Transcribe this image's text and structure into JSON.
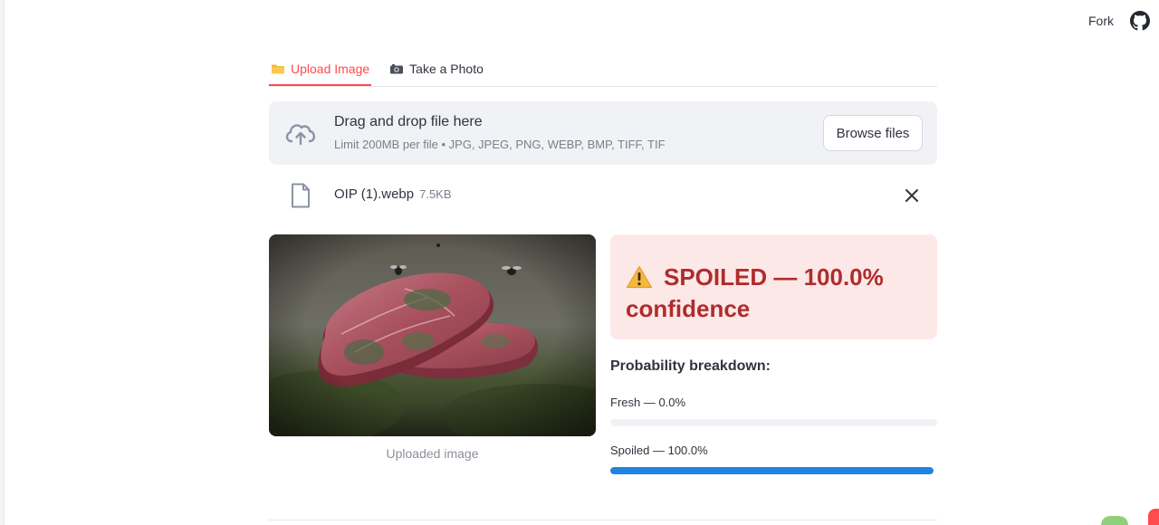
{
  "header": {
    "fork_label": "Fork",
    "github_icon": "github-icon"
  },
  "tabs": [
    {
      "label": "Upload Image",
      "icon": "folder-icon",
      "active": true
    },
    {
      "label": "Take a Photo",
      "icon": "camera-icon",
      "active": false
    }
  ],
  "uploader": {
    "title": "Drag and drop file here",
    "subtitle": "Limit 200MB per file • JPG, JPEG, PNG, WEBP, BMP, TIFF, TIF",
    "browse_label": "Browse files",
    "icon": "cloud-upload-icon"
  },
  "file": {
    "name": "OIP (1).webp",
    "size": "7.5KB",
    "icon": "file-icon"
  },
  "image": {
    "caption": "Uploaded image"
  },
  "result": {
    "text": "SPOILED — 100.0% confidence",
    "icon": "warning-icon",
    "color": "#b02c2c",
    "background": "#fde8e8"
  },
  "probabilities": {
    "title": "Probability breakdown:",
    "items": [
      {
        "label": "Fresh — 0.0%",
        "value": 0.0
      },
      {
        "label": "Spoiled — 100.0%",
        "value": 1.0
      }
    ]
  },
  "colors": {
    "accent": "#ff4b4b",
    "progress": "#1f84e0"
  }
}
